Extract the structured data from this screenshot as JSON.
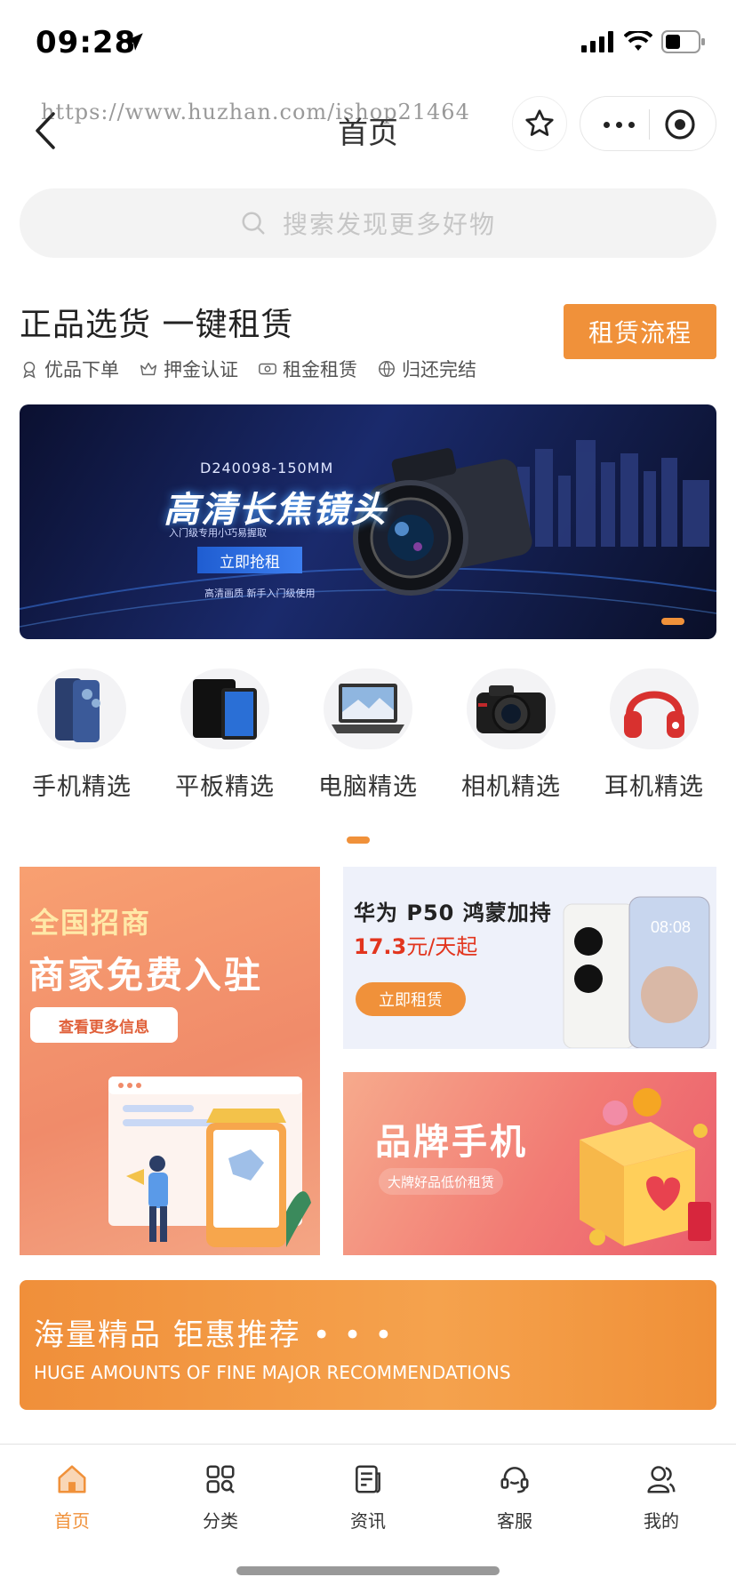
{
  "status_bar": {
    "time": "09:28"
  },
  "nav": {
    "title": "首页",
    "watermark": "https://www.huzhan.com/ishop21464"
  },
  "search": {
    "placeholder": "搜索发现更多好物"
  },
  "intro": {
    "title": "正品选货 一键租赁",
    "process_button": "租赁流程",
    "features": [
      {
        "label": "优品下单",
        "icon": "badge-icon"
      },
      {
        "label": "押金认证",
        "icon": "crown-icon"
      },
      {
        "label": "租金租赁",
        "icon": "money-icon"
      },
      {
        "label": "归还完结",
        "icon": "globe-icon"
      }
    ]
  },
  "banner": {
    "code": "D240098-150MM",
    "title": "高清长焦镜头",
    "subtitle": "入门级专用小巧易握取",
    "cta": "立即抢租",
    "note": "高清画质 新手入门级使用"
  },
  "categories": [
    {
      "label": "手机精选",
      "icon": "phone-icon"
    },
    {
      "label": "平板精选",
      "icon": "tablet-icon"
    },
    {
      "label": "电脑精选",
      "icon": "laptop-icon"
    },
    {
      "label": "相机精选",
      "icon": "camera-icon"
    },
    {
      "label": "耳机精选",
      "icon": "headphones-icon"
    }
  ],
  "promos": {
    "left": {
      "small": "全国招商",
      "big": "商家免费入驻",
      "button": "查看更多信息"
    },
    "right_top": {
      "title": "华为 P50 鸿蒙加持",
      "price_value": "17.3",
      "price_unit": "元/天起",
      "button": "立即租赁"
    },
    "right_bottom": {
      "title": "品牌手机",
      "subtitle": "大牌好品低价租赁"
    }
  },
  "recommend": {
    "title": "海量精品 钜惠推荐 • • •",
    "subtitle": "HUGE AMOUNTS OF FINE MAJOR RECOMMENDATIONS"
  },
  "tabbar": {
    "items": [
      {
        "label": "首页",
        "icon": "home-icon",
        "active": true
      },
      {
        "label": "分类",
        "icon": "category-icon",
        "active": false
      },
      {
        "label": "资讯",
        "icon": "news-icon",
        "active": false
      },
      {
        "label": "客服",
        "icon": "customer-service-icon",
        "active": false
      },
      {
        "label": "我的",
        "icon": "user-icon",
        "active": false
      }
    ]
  },
  "colors": {
    "accent": "#f0913a",
    "price": "#e2351e",
    "active_tab": "#f0913a"
  }
}
